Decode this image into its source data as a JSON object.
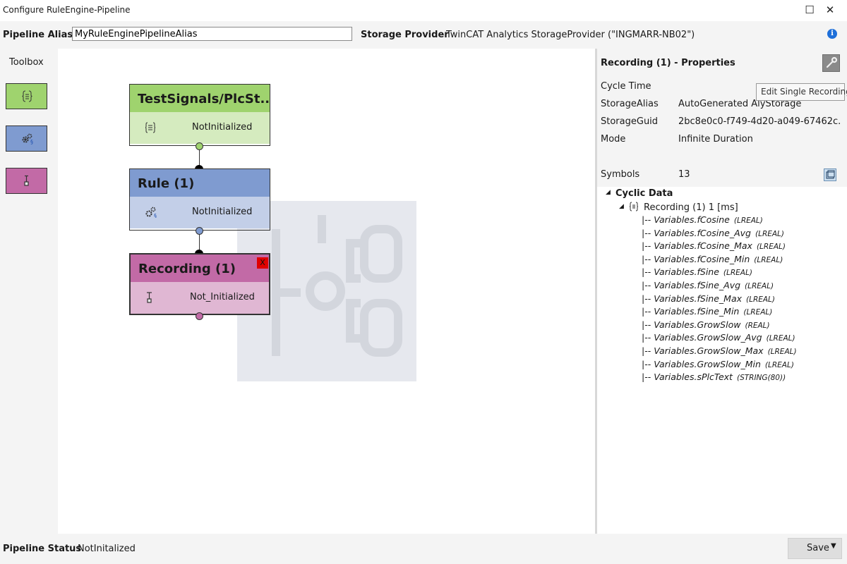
{
  "window": {
    "title": "Configure RuleEngine-Pipeline",
    "maximize_glyph": "☐",
    "close_glyph": "✕"
  },
  "topbar": {
    "alias_label": "Pipeline Alias",
    "alias_value": "MyRuleEnginePipelineAlias",
    "storage_label": "Storage Provider",
    "storage_value": "TwinCAT Analytics StorageProvider (\"INGMARR-NB02\")",
    "info_glyph": "i"
  },
  "toolbox": {
    "title": "Toolbox",
    "items": [
      {
        "name": "signal-tool",
        "color": "#9fd36e"
      },
      {
        "name": "rule-tool",
        "color": "#7f9bd0"
      },
      {
        "name": "recording-tool",
        "color": "#c26aa6"
      }
    ]
  },
  "nodes": [
    {
      "title": "TestSignals/PlcSt...",
      "status": "NotInitialized",
      "head_color": "#9fd36e",
      "body_color": "#d5ebbf",
      "icon": "braces-icon"
    },
    {
      "title": "Rule (1)",
      "status": "NotInitialized",
      "head_color": "#7f9bd0",
      "body_color": "#c3cfe8",
      "icon": "gears-icon"
    },
    {
      "title": "Recording (1)",
      "status": "Not_Initialized",
      "head_color": "#c26aa6",
      "body_color": "#e0b7d3",
      "icon": "recording-icon",
      "close_glyph": "X"
    }
  ],
  "properties": {
    "title": "Recording (1) - Properties",
    "tooltip": "Edit Single Recording",
    "rows": [
      {
        "key": "Cycle Time",
        "value": ""
      },
      {
        "key": "StorageAlias",
        "value": "AutoGenerated AlyStorage"
      },
      {
        "key": "StorageGuid",
        "value": "2bc8e0c0-f749-4d20-a049-67462c..."
      },
      {
        "key": "Mode",
        "value": "Infinite Duration"
      }
    ],
    "symbols_label": "Symbols",
    "symbols_count": "13",
    "tree": {
      "root": "Cyclic Data",
      "child": "Recording (1) 1 [ms]",
      "expand_glyph": "◢",
      "leaves": [
        {
          "name": "Variables.fCosine",
          "type": "(LREAL)"
        },
        {
          "name": "Variables.fCosine_Avg",
          "type": "(LREAL)"
        },
        {
          "name": "Variables.fCosine_Max",
          "type": "(LREAL)"
        },
        {
          "name": "Variables.fCosine_Min",
          "type": "(LREAL)"
        },
        {
          "name": "Variables.fSine",
          "type": "(LREAL)"
        },
        {
          "name": "Variables.fSine_Avg",
          "type": "(LREAL)"
        },
        {
          "name": "Variables.fSine_Max",
          "type": "(LREAL)"
        },
        {
          "name": "Variables.fSine_Min",
          "type": "(LREAL)"
        },
        {
          "name": "Variables.GrowSlow",
          "type": "(REAL)"
        },
        {
          "name": "Variables.GrowSlow_Avg",
          "type": "(LREAL)"
        },
        {
          "name": "Variables.GrowSlow_Max",
          "type": "(LREAL)"
        },
        {
          "name": "Variables.GrowSlow_Min",
          "type": "(LREAL)"
        },
        {
          "name": "Variables.sPlcText",
          "type": "(STRING(80))"
        }
      ],
      "leaf_prefix": "|-- "
    }
  },
  "status": {
    "label": "Pipeline Status",
    "value": "NotInitalized",
    "save_label": "Save",
    "dropdown_glyph": "▼"
  }
}
